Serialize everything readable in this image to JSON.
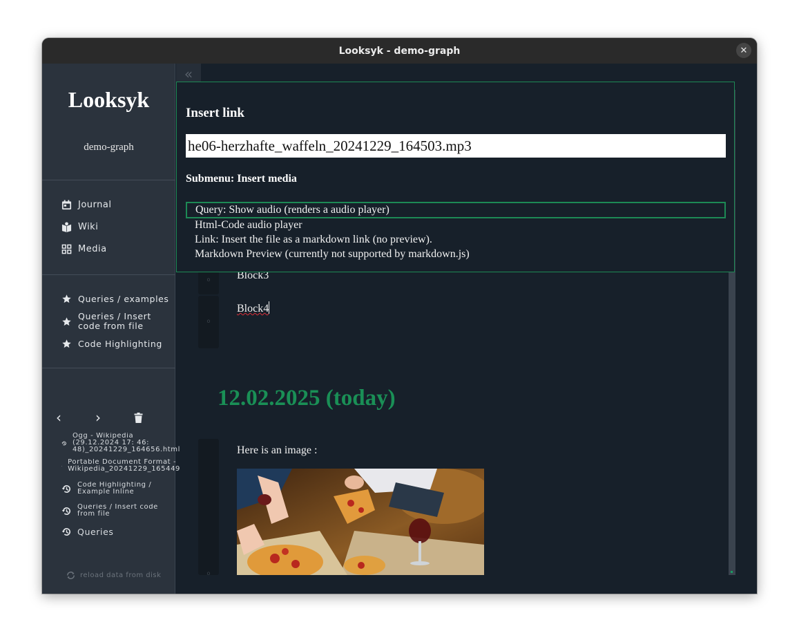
{
  "window": {
    "title": "Looksyk - demo-graph",
    "close_glyph": "✕"
  },
  "sidebar": {
    "app_name": "Looksyk",
    "graph_name": "demo-graph",
    "nav": [
      {
        "label": "Journal",
        "icon": "calendar-icon"
      },
      {
        "label": "Wiki",
        "icon": "book-icon"
      },
      {
        "label": "Media",
        "icon": "grid-icon"
      }
    ],
    "favourites": [
      {
        "label": "Queries / examples",
        "icon": "star-icon"
      },
      {
        "label": "Queries / Insert\ncode from file",
        "icon": "star-icon"
      },
      {
        "label": "Code Highlighting",
        "icon": "star-icon"
      }
    ],
    "history_controls": {
      "back_glyph": "‹",
      "forward_glyph": "›",
      "clear_icon": "trash-icon"
    },
    "history": [
      {
        "label": "Ogg - Wikipedia\n(29.12.2024 17: 46:\n48)_20241229_164656.html",
        "icon": "history-icon"
      },
      {
        "label": "Portable Document Format -\nWikipedia_20241229_165449",
        "icon": "history-icon"
      },
      {
        "label": "Code Highlighting /\nExample Inline",
        "icon": "history-icon"
      },
      {
        "label": "Queries / Insert code\nfrom file",
        "icon": "history-icon"
      },
      {
        "label": "Queries",
        "icon": "history-icon"
      }
    ],
    "reload_label": "reload data from disk"
  },
  "main": {
    "collapse_glyph": "«",
    "blocks": [
      {
        "text": "Block3"
      },
      {
        "text": "Block4"
      }
    ],
    "gutter_glyph": "o",
    "day_title": "12.02.2025 (today)",
    "image_block_text": "Here is an image :",
    "image_alt": "pizza-photo"
  },
  "dialog": {
    "title": "Insert link",
    "input_value": "he06-herzhafte_waffeln_20241229_164503.mp3",
    "submenu_title": "Submenu: Insert media",
    "options": [
      {
        "label": "Query: Show audio (renders a audio player)",
        "selected": true
      },
      {
        "label": "Html-Code audio player",
        "selected": false
      },
      {
        "label": "Link: Insert the file as a markdown link (no preview).",
        "selected": false
      },
      {
        "label": "Markdown Preview (currently not supported by markdown.js)",
        "selected": false
      }
    ]
  },
  "colors": {
    "accent_green": "#1d8a55",
    "day_title_green": "#1a8f56",
    "background": "#17202a",
    "sidebar": "#2b333d"
  }
}
